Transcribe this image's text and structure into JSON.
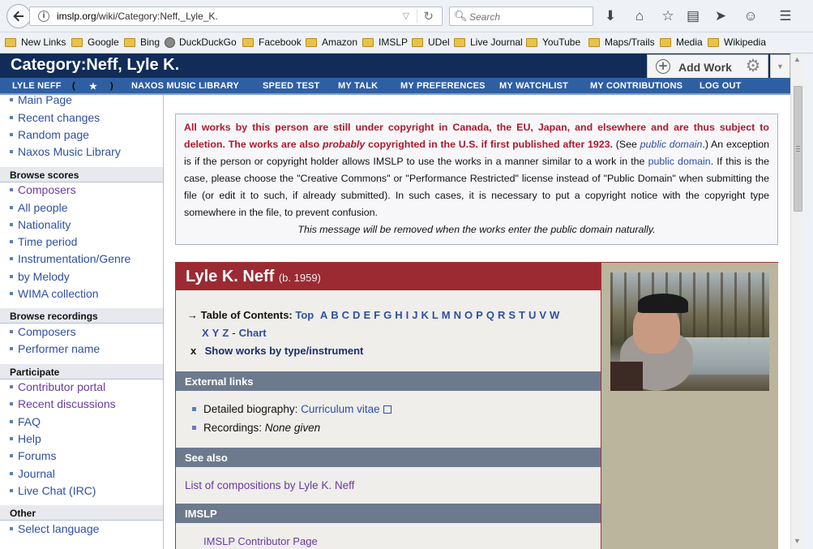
{
  "browser": {
    "url_host": "imslp.org",
    "url_path": "/wiki/Category:Neff,_Lyle_K.",
    "search_placeholder": "Search",
    "bookmarks": [
      "New Links",
      "Google",
      "Bing",
      "DuckDuckGo",
      "Facebook",
      "Amazon",
      "IMSLP",
      "UDel",
      "Live Journal",
      "YouTube",
      "Maps/Trails",
      "Media",
      "Wikipedia"
    ]
  },
  "header": {
    "title": "Category:Neff, Lyle K.",
    "add_work": "Add Work"
  },
  "nav_tabs": {
    "lyle_neff": "LYLE NEFF",
    "paren_open": "(",
    "star": "★",
    "paren_close": ")",
    "naxos": "NAXOS MUSIC LIBRARY",
    "speed_test": "SPEED TEST",
    "my_talk": "MY TALK",
    "my_preferences": "MY PREFERENCES",
    "my_watchlist": "MY WATCHLIST",
    "my_contributions": "MY CONTRIBUTIONS",
    "log_out": "LOG OUT"
  },
  "sidebar": {
    "top_items": [
      "Main Page",
      "Recent changes",
      "Random page",
      "Naxos Music Library"
    ],
    "browse_scores_title": "Browse scores",
    "browse_scores": [
      "Composers",
      "All people",
      "Nationality",
      "Time period",
      "Instrumentation/Genre",
      "by Melody",
      "WIMA collection"
    ],
    "browse_recordings_title": "Browse recordings",
    "browse_recordings": [
      "Composers",
      "Performer name"
    ],
    "participate_title": "Participate",
    "participate": [
      "Contributor portal",
      "Recent discussions",
      "FAQ",
      "Help",
      "Forums",
      "Journal",
      "Live Chat (IRC)"
    ],
    "other_title": "Other",
    "other": [
      "Select language"
    ]
  },
  "notice": {
    "red": "All works by this person are still under copyright in Canada, the EU, Japan, and elsewhere and are thus subject to deletion. The works are also ",
    "red_italic": "probably",
    "red_tail": " copyrighted in the U.S. if first published after 1923.",
    "see_pre": " (See ",
    "pd_link": "public domain",
    "see_post": ".) An exception is if the person or copyright holder allows IMSLP to use the works in a manner similar to a work in the ",
    "pd_link2": "public domain",
    "rest": ". If this is the case, please choose the \"Creative Commons\" or \"Performance Restricted\" license instead of \"Public Domain\" when submitting the file (or edit it to such, if already submitted). In such cases, it is necessary to put a copyright notice with the copyright type somewhere in the file, to prevent confusion.",
    "footer": "This message will be removed when the works enter the public domain naturally."
  },
  "composer": {
    "name": "Lyle K. Neff",
    "birth": "(b. 1959)",
    "toc_arrow": "→",
    "toc_label": "Table of Contents:",
    "toc_top": "Top",
    "toc_letters_row1": [
      "A",
      "B",
      "C",
      "D",
      "E",
      "F",
      "G",
      "H",
      "I",
      "J",
      "K",
      "L",
      "M",
      "N",
      "O",
      "P",
      "Q",
      "R",
      "S",
      "T",
      "U",
      "V",
      "W"
    ],
    "toc_letters_row2": [
      "X",
      "Y",
      "Z"
    ],
    "toc_dash": "-",
    "toc_chart": "Chart",
    "show_x": "x",
    "show_works": "Show works by type/instrument"
  },
  "sections": {
    "external_links": "External links",
    "bio_label": "Detailed biography: ",
    "bio_link": "Curriculum vitae",
    "recordings_label": "Recordings: ",
    "recordings_value": "None given",
    "see_also": "See also",
    "see_also_link": "List of compositions by Lyle K. Neff",
    "imslp": "IMSLP",
    "imslp_cut_link": "IMSLP Contributor Page"
  },
  "icons": [
    "back-arrow-icon",
    "info-icon",
    "reload-icon",
    "search-icon",
    "download-icon",
    "home-icon",
    "star-icon",
    "reading-list-icon",
    "send-icon",
    "smiley-icon",
    "menu-icon",
    "folder-icon",
    "globe-icon",
    "add-icon",
    "gear-icon",
    "external-link-icon"
  ]
}
